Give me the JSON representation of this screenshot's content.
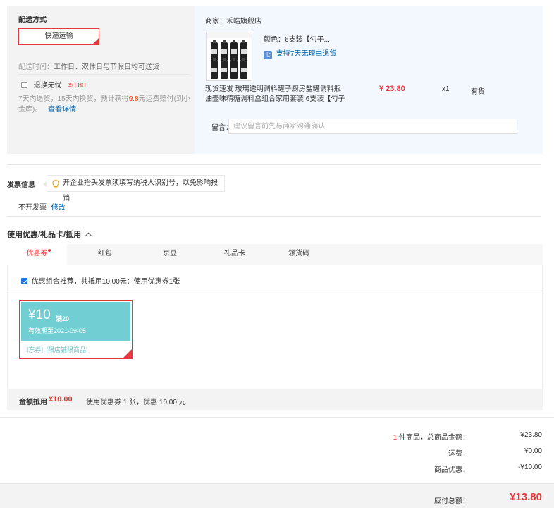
{
  "shipping": {
    "title": "配送方式",
    "method_label": "快递运输",
    "time_label": "配送时间：",
    "time_value": "工作日、双休日与节假日均可送货",
    "worry_free_label": "退换无忧",
    "worry_free_price": "¥0.80",
    "worry_free_desc_1": "7天内退货，15天内换货，预计获得",
    "worry_free_amount": "9.8",
    "worry_free_desc_2": "元运费赔付(到小",
    "worry_free_desc_3": "金库)。",
    "worry_free_link": "查看详情"
  },
  "merchant": {
    "shop_label": "商家：禾皓旗舰店",
    "color_label": "颜色：6支装【勺子...",
    "return_badge": "七",
    "return_policy": "支持7天无理由退货",
    "product_title_1": "现货速发 玻璃透明调料罐子厨房盐罐调料瓶",
    "product_title_2": "油壶味精糖调料盒组合家用套装 6支装【勺子",
    "price": "¥ 23.80",
    "qty": "x1",
    "stock": "有货",
    "remark_label": "留言：",
    "remark_placeholder": "建议留言前先与商家沟通确认"
  },
  "invoice": {
    "title": "发票信息",
    "tip": "开企业抬头发票须填写纳税人识别号，以免影响报销",
    "status": "不开发票",
    "edit_link": "修改"
  },
  "discount": {
    "title": "使用优惠/礼品卡/抵用",
    "tabs": [
      "优惠券",
      "红包",
      "京豆",
      "礼品卡",
      "领货码"
    ],
    "recommend_text": "优惠组合推荐，共抵用10.00元：使用优惠券1张",
    "coupon": {
      "amount": "¥10",
      "threshold": "满20",
      "validity": "有效期至2021-09-05",
      "tag_1": "[东券]",
      "tag_2": "[限店铺限商品]"
    },
    "summary_label": "金额抵用",
    "summary_amount": "¥10.00",
    "summary_desc": "使用优惠券 1 张，优惠 10.00 元"
  },
  "totals": {
    "item_count": "1",
    "item_label": " 件商品，总商品金额：",
    "item_amount": "¥23.80",
    "shipping_label": "运费：",
    "shipping_amount": "¥0.00",
    "discount_label": "商品优惠：",
    "discount_amount": "-¥10.00",
    "payable_label": "应付总额：",
    "payable_amount": "¥13.80"
  },
  "colors": {
    "accent_red": "#e4393c",
    "coupon_teal": "#71cfd4",
    "link_blue": "#005ea7"
  }
}
